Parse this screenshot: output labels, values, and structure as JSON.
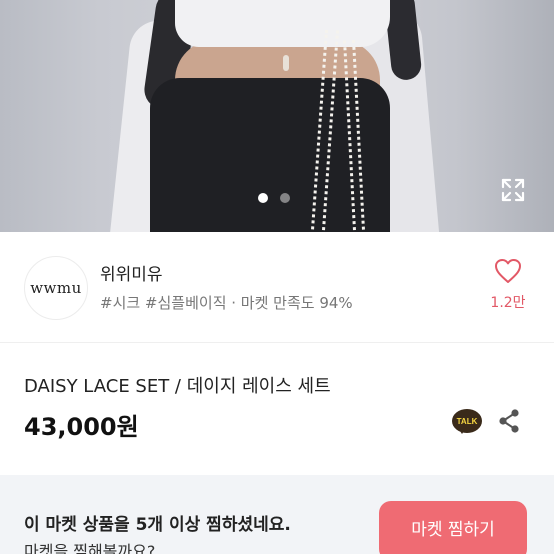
{
  "carousel": {
    "slide_count": 2,
    "active_index": 0
  },
  "shop": {
    "logo_text": "wwmu",
    "name": "위위미유",
    "meta": "#시크 #심플베이직 · 마켓 만족도 94%",
    "like_count": "1.2만"
  },
  "product": {
    "title": "DAISY LACE SET / 데이지 레이스 세트",
    "price": "43,000원",
    "talk_label": "TALK"
  },
  "banner": {
    "line1": "이 마켓 상품을 5개 이상 찜하셨네요.",
    "line2": "마켓을 찜해볼까요?",
    "button_label": "마켓 찜하기"
  },
  "colors": {
    "accent": "#ef6b73",
    "heart": "#e25866",
    "banner_bg": "#f2f4f7"
  },
  "icons": {
    "expand": "expand-icon",
    "heart": "heart-icon",
    "talk": "kakaotalk-icon",
    "share": "share-icon"
  }
}
